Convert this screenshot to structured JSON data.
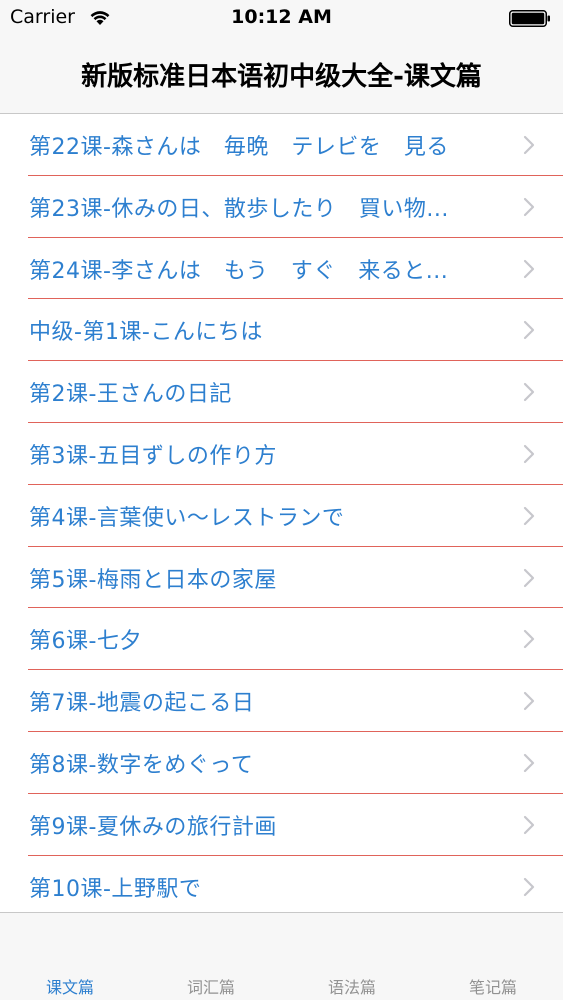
{
  "status": {
    "carrier": "Carrier",
    "time": "10:12 AM",
    "wifi_icon": "wifi-icon",
    "battery_icon": "battery-icon"
  },
  "nav": {
    "title": "新版标准日本语初中级大全-课文篇"
  },
  "lessons": [
    {
      "label": "第22课-森さんは　毎晩　テレビを　見る"
    },
    {
      "label": "第23课-休みの日、散歩したり　買い物..."
    },
    {
      "label": "第24课-李さんは　もう　すぐ　来ると..."
    },
    {
      "label": "中级-第1课-こんにちは"
    },
    {
      "label": "第2课-王さんの日記"
    },
    {
      "label": "第3课-五目ずしの作り方"
    },
    {
      "label": "第4课-言葉使い～レストランで"
    },
    {
      "label": "第5课-梅雨と日本の家屋"
    },
    {
      "label": "第6课-七夕"
    },
    {
      "label": "第7课-地震の起こる日"
    },
    {
      "label": "第8课-数字をめぐって"
    },
    {
      "label": "第9课-夏休みの旅行計画"
    },
    {
      "label": "第10课-上野駅で"
    }
  ],
  "tabs": [
    {
      "label": "课文篇",
      "active": true
    },
    {
      "label": "词汇篇",
      "active": false
    },
    {
      "label": "语法篇",
      "active": false
    },
    {
      "label": "笔记篇",
      "active": false
    }
  ],
  "colors": {
    "accent": "#2d7fcf",
    "separator": "#e0635a",
    "chevron": "#c7c7cc",
    "tab_inactive": "#929292"
  }
}
